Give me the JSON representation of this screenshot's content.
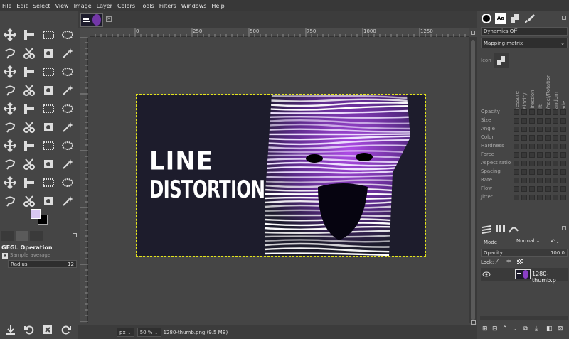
{
  "menu": [
    "File",
    "Edit",
    "Select",
    "View",
    "Image",
    "Layer",
    "Colors",
    "Tools",
    "Filters",
    "Windows",
    "Help"
  ],
  "colors": {
    "accent": "#8a3fc8",
    "fg_swatch": "#d8c7f0",
    "bg_swatch": "#000000",
    "artwork_bg": "#1d1c2c"
  },
  "ruler": {
    "h_labels": [
      "0",
      "250",
      "500",
      "750",
      "1000",
      "1250"
    ]
  },
  "artwork": {
    "line1": "LINE",
    "line2": "DISTORTION"
  },
  "tool_options": {
    "title": "GEGL Operation",
    "sample_average": "Sample average",
    "radius_label": "Radius",
    "radius_value": "12"
  },
  "status": {
    "unit": "px",
    "zoom": "50 %",
    "file_info": "1280-thumb.png (9.5 MB)"
  },
  "dynamics": {
    "preset": "Dynamics Off",
    "mapping": "Mapping matrix",
    "icon_label": "Icon",
    "columns": [
      "Pressure",
      "Velocity",
      "Direction",
      "Tilt",
      "Wheel/Rotation",
      "Random",
      "Fade"
    ],
    "rows": [
      "Opacity",
      "Size",
      "Angle",
      "Color",
      "Hardness",
      "Force",
      "Aspect ratio",
      "Spacing",
      "Rate",
      "Flow",
      "Jitter"
    ]
  },
  "layers": {
    "mode_label": "Mode",
    "mode_value": "Normal",
    "opacity_label": "Opacity",
    "opacity_value": "100.0",
    "lock_label": "Lock:",
    "layer_name": "1280-thumb.p"
  },
  "icons": [
    "move-icon",
    "align-icon",
    "rect-select-icon",
    "ellipse-select-icon",
    "free-select-icon",
    "scissors-icon",
    "fuzzy-select-icon",
    "crop-icon",
    "transform-icon",
    "paint-icon",
    "pencil-icon",
    "eraser-icon",
    "text-icon",
    "zoom-icon",
    "measure-icon",
    "eye-icon",
    "reset-icon",
    "save-icon"
  ]
}
